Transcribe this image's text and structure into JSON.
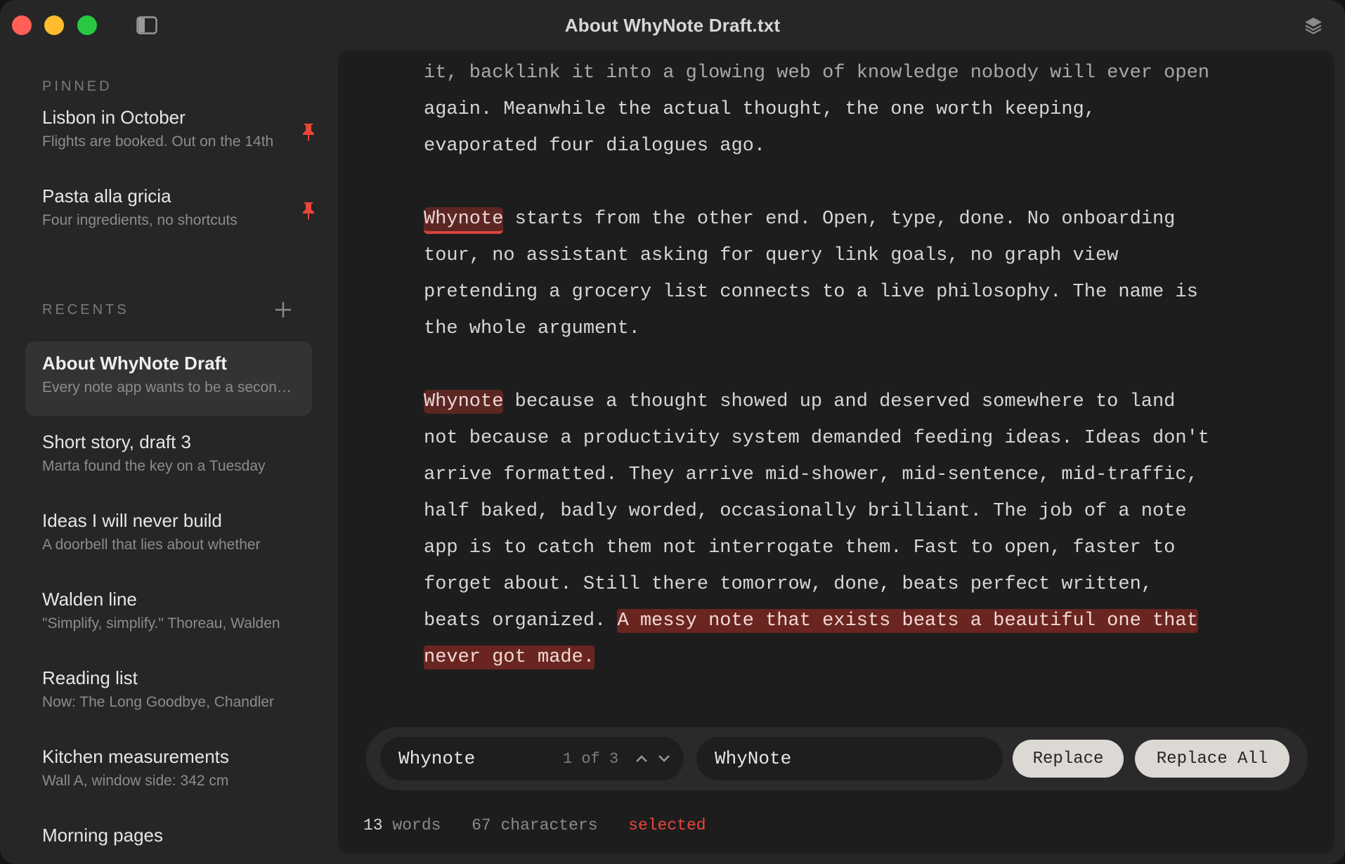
{
  "window": {
    "title": "About WhyNote Draft.txt"
  },
  "sidebar": {
    "pinned_label": "PINNED",
    "recents_label": "RECENTS",
    "pinned": [
      {
        "title": "Lisbon in October",
        "preview": "Flights are booked. Out on the 14th"
      },
      {
        "title": "Pasta alla gricia",
        "preview": "Four ingredients, no shortcuts"
      }
    ],
    "recents": [
      {
        "title": "About WhyNote Draft",
        "preview": "Every note app wants to be a second brain"
      },
      {
        "title": "Short story, draft 3",
        "preview": "Marta found the key on a Tuesday"
      },
      {
        "title": "Ideas I will never build",
        "preview": "A doorbell that lies about whether"
      },
      {
        "title": "Walden line",
        "preview": "\"Simplify, simplify.\" Thoreau, Walden"
      },
      {
        "title": "Reading list",
        "preview": "Now: The Long Goodbye, Chandler"
      },
      {
        "title": "Kitchen measurements",
        "preview": "Wall A, window side: 342 cm"
      },
      {
        "title": "Morning pages",
        "preview": ""
      }
    ]
  },
  "editor": {
    "p1": {
      "l1": "it, backlink it into a glowing web of knowledge nobody will ever open",
      "l2": "again. Meanwhile the actual thought, the one worth keeping,",
      "l3": "evaporated four dialogues ago."
    },
    "p2": {
      "match": "Whynote",
      "l1_rest": " starts from the other end. Open, type, done. No onboarding",
      "l2": "tour, no assistant asking for query link goals, no graph view",
      "l3": "pretending a grocery list connects to a live philosophy. The name is",
      "l4": "the whole argument."
    },
    "p3": {
      "match": "Whynote",
      "l1_rest": " because a thought showed up and deserved somewhere to land",
      "l2": "not because a productivity system demanded feeding ideas. Ideas don't",
      "l3": "arrive formatted. They arrive mid-shower, mid-sentence, mid-traffic,",
      "l4": "half baked, badly worded, occasionally brilliant. The job of a note",
      "l5": "app is to catch them not interrogate them. Fast to open, faster to",
      "l6": "forget about. Still there tomorrow, done, beats perfect written,",
      "l7_pre": "beats organized. ",
      "l7_sel": "A messy note that exists beats a beautiful one that",
      "l8_sel": "never got made."
    }
  },
  "findbar": {
    "find_value": "Whynote",
    "match_count": "1 of 3",
    "replace_value": "WhyNote",
    "replace_label": "Replace",
    "replace_all_label": "Replace All"
  },
  "status": {
    "words_count": "13",
    "words_label": "words",
    "chars_count": "67",
    "chars_label": "characters",
    "selected_label": "selected"
  },
  "colors": {
    "accent_red": "#e8453b",
    "highlight": "#5c2622",
    "selection": "#6a2520",
    "pin": "#e8453b"
  }
}
